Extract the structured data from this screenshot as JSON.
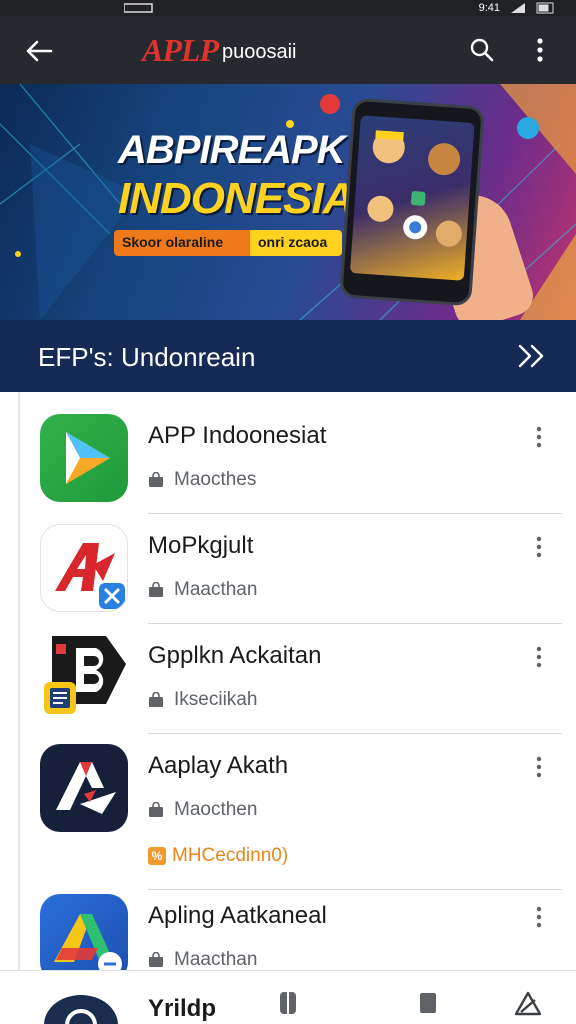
{
  "status_bar": {
    "time": "9:41"
  },
  "app_bar": {
    "logo_mark": "APLP",
    "logo_text": "puoosaii"
  },
  "banner": {
    "title_line1": "ABPIREAPK",
    "title_line2": "INDONESIA",
    "pill_left": "Skoor olaraline",
    "pill_right": "onri zcaoa"
  },
  "section": {
    "title": "EFP's: Undonreain"
  },
  "apps": [
    {
      "name": "APP Indoonesiat",
      "meta": "Maocthes",
      "icon": "play-triangle-icon"
    },
    {
      "name": "MoPkgjult",
      "meta": "Maacthan",
      "icon": "red-a-logo-icon"
    },
    {
      "name": "Gpplkn Ackaitan",
      "meta": "Ikseciikah",
      "icon": "b-logo-icon"
    },
    {
      "name": "Aaplay Akath",
      "meta": "Maocthen",
      "icon": "dark-a-logo-icon",
      "extra": "MHCecdinn0)"
    },
    {
      "name": "Apling Aatkaneal",
      "meta": "Maacthan",
      "icon": "colorful-a-logo-icon"
    }
  ],
  "bottom_nav": {
    "label": "Yrildp"
  },
  "colors": {
    "app_bar": "#26292e",
    "section_bar": "#152a55",
    "accent_yellow": "#ffd21f",
    "accent_orange": "#f07a1a",
    "brand_red": "#e0322c"
  }
}
